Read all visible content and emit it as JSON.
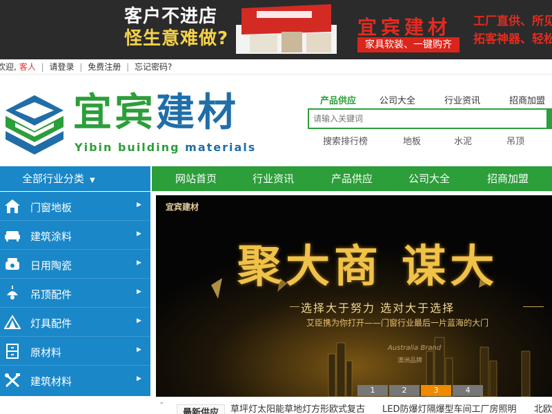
{
  "top_banner": {
    "line1": "客户不进店",
    "line2": "怪生意难做?",
    "brand": "宜宾建材",
    "sub": "家具软装、一键购齐",
    "right1": "工厂直供、所见",
    "right2": "拓客神器、轻松"
  },
  "login_bar": {
    "welcome": "欢迎,",
    "guest": "客人",
    "sep": "|",
    "login": "请登录",
    "register": "免费注册",
    "forgot": "忘记密码?"
  },
  "logo": {
    "cn_part1": "宜宾",
    "cn_part2": "建材",
    "en_part1": "Yibin building",
    "en_part2": "materials"
  },
  "search": {
    "tabs": [
      "产品供应",
      "公司大全",
      "行业资讯",
      "招商加盟"
    ],
    "placeholder": "请输入关键词",
    "hot_words": [
      "搜索排行榜",
      "地板",
      "水泥",
      "吊顶"
    ]
  },
  "nav": {
    "category_label": "全部行业分类",
    "items": [
      "网站首页",
      "行业资讯",
      "产品供应",
      "公司大全",
      "招商加盟"
    ]
  },
  "side_menu": [
    {
      "label": "门窗地板",
      "icon": "house-icon"
    },
    {
      "label": "建筑涂料",
      "icon": "sofa-icon"
    },
    {
      "label": "日用陶瓷",
      "icon": "ceramic-icon"
    },
    {
      "label": "吊顶配件",
      "icon": "lamp-icon"
    },
    {
      "label": "灯具配件",
      "icon": "tent-icon"
    },
    {
      "label": "原材料",
      "icon": "cabinet-icon"
    },
    {
      "label": "建筑材料",
      "icon": "tools-icon"
    }
  ],
  "hero": {
    "tag": "宜宾建材",
    "title": "聚大商 谋大",
    "slogan": "选择大于努力   选对大于选择",
    "sub": "艾臣携为你打开——门窗行业最后一片蓝海的大门",
    "brand_en": "Australia Brand",
    "brand_cn": "澳洲品牌",
    "dots": [
      "1",
      "2",
      "3",
      "4"
    ],
    "active_dot": "3"
  },
  "ticker": {
    "label": "最新供应",
    "items": [
      "草坪灯太阳能草地灯方形欧式复古",
      "LED防爆灯隔爆型车间工厂房照明",
      "北欧"
    ]
  },
  "colors": {
    "green": "#2c9e3a",
    "blue": "#1a87c8",
    "orange": "#f08a00",
    "gold": "#f0c24a"
  }
}
